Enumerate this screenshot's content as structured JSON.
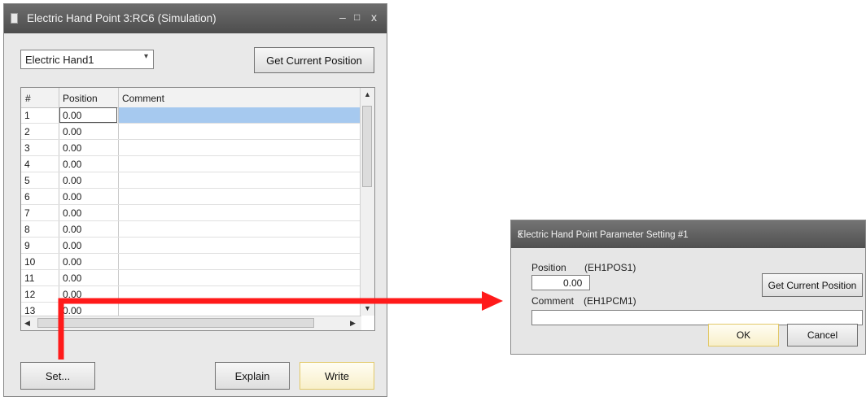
{
  "main_window": {
    "title": "Electric Hand Point 3:RC6  (Simulation)",
    "controls": {
      "minimize": "–",
      "maximize": "□",
      "close": "x"
    },
    "hand_select": {
      "value": "Electric Hand1",
      "arrow": "▾"
    },
    "get_current_position_label": "Get Current Position",
    "table": {
      "columns": [
        "#",
        "Position",
        "Comment"
      ],
      "rows": [
        {
          "num": "1",
          "position": "0.00",
          "comment": ""
        },
        {
          "num": "2",
          "position": "0.00",
          "comment": ""
        },
        {
          "num": "3",
          "position": "0.00",
          "comment": ""
        },
        {
          "num": "4",
          "position": "0.00",
          "comment": ""
        },
        {
          "num": "5",
          "position": "0.00",
          "comment": ""
        },
        {
          "num": "6",
          "position": "0.00",
          "comment": ""
        },
        {
          "num": "7",
          "position": "0.00",
          "comment": ""
        },
        {
          "num": "8",
          "position": "0.00",
          "comment": ""
        },
        {
          "num": "9",
          "position": "0.00",
          "comment": ""
        },
        {
          "num": "10",
          "position": "0.00",
          "comment": ""
        },
        {
          "num": "11",
          "position": "0.00",
          "comment": ""
        },
        {
          "num": "12",
          "position": "0.00",
          "comment": ""
        },
        {
          "num": "13",
          "position": "0.00",
          "comment": ""
        }
      ],
      "selected_row": "1"
    },
    "buttons": {
      "set": "Set...",
      "explain": "Explain",
      "write": "Write"
    }
  },
  "dialog": {
    "title": "Electric Hand Point Parameter Setting #1",
    "close": "x",
    "position_label": "Position",
    "position_param": "(EH1POS1)",
    "position_value": "0.00",
    "get_current_position_label": "Get Current Position",
    "comment_label": "Comment",
    "comment_param": "(EH1PCM1)",
    "comment_value": "",
    "ok_label": "OK",
    "cancel_label": "Cancel"
  },
  "colors": {
    "arrow": "#ff1a1a",
    "selection": "#a6c9ef",
    "titlebar": "#5a5a5a"
  }
}
